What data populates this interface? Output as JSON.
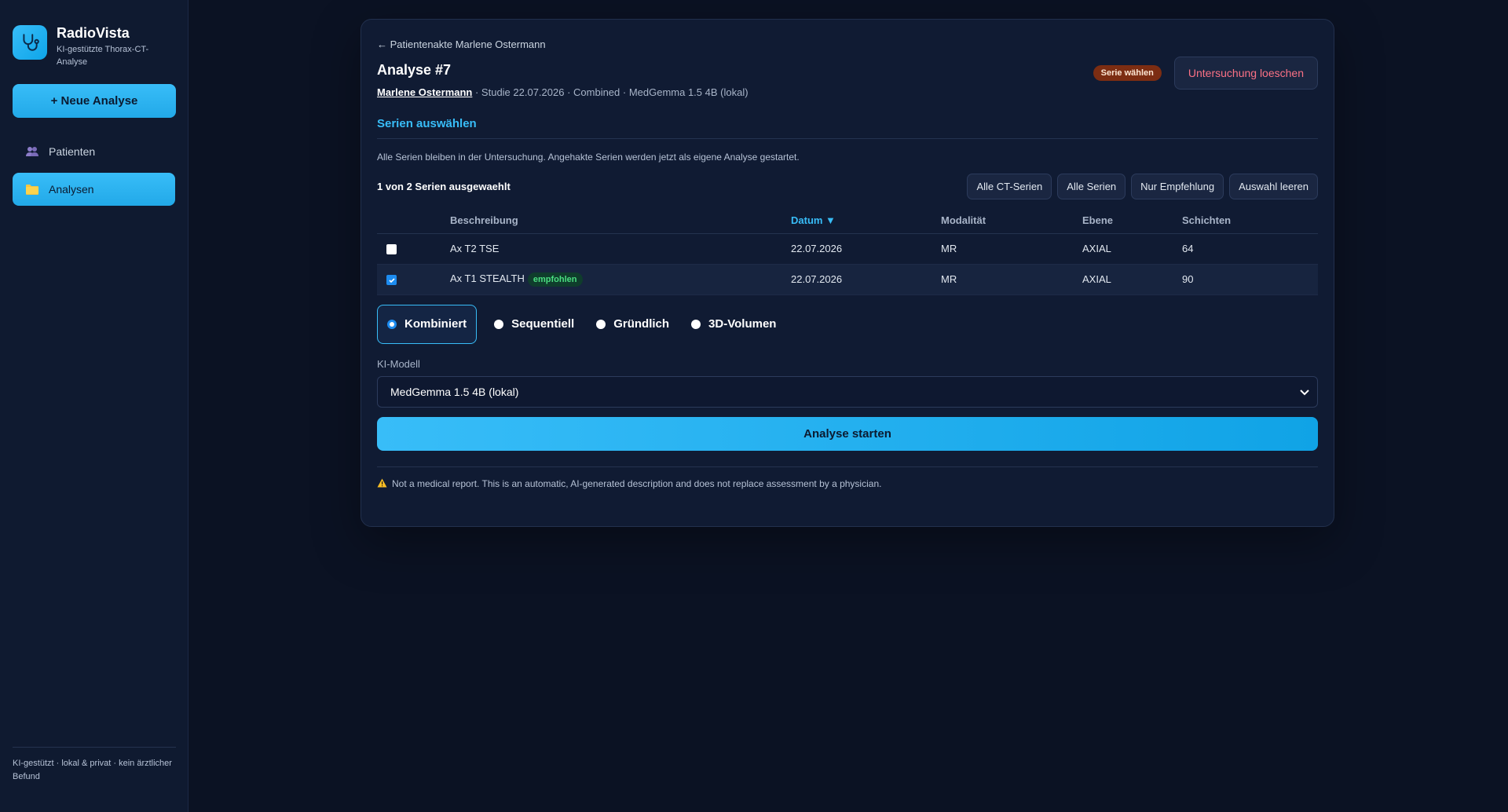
{
  "brand": {
    "name": "RadioVista",
    "subtitle": "KI-gestützte Thorax-CT-Analyse"
  },
  "sidebar": {
    "new_button": "+ Neue Analyse",
    "items": [
      {
        "label": "Patienten",
        "icon": "users-icon",
        "active": false
      },
      {
        "label": "Analysen",
        "icon": "folder-icon",
        "active": true
      }
    ],
    "footer": "KI-gestützt · lokal & privat · kein ärztlicher Befund"
  },
  "header": {
    "back_link": "← Patientenakte Marlene Ostermann",
    "title": "Analyse #7",
    "patient_name": "Marlene Ostermann",
    "meta_rest": " · Studie 22.07.2026 · Combined · MedGemma 1.5 4B (lokal)",
    "status_badge": "Serie wählen",
    "delete_button": "Untersuchung loeschen"
  },
  "series_section": {
    "title": "Serien auswählen",
    "info": "Alle Serien bleiben in der Untersuchung. Angehakte Serien werden jetzt als eigene Analyse gestartet.",
    "selection_count": "1 von 2 Serien ausgewaehlt",
    "filter_buttons": [
      "Alle CT-Serien",
      "Alle Serien",
      "Nur Empfehlung",
      "Auswahl leeren"
    ],
    "columns": [
      "Beschreibung",
      "Datum ▼",
      "Modalität",
      "Ebene",
      "Schichten"
    ],
    "rows": [
      {
        "checked": false,
        "description": "Ax T2 TSE",
        "badge": "",
        "date": "22.07.2026",
        "modality": "MR",
        "plane": "AXIAL",
        "slices": "64"
      },
      {
        "checked": true,
        "description": "Ax T1 STEALTH",
        "badge": "empfohlen",
        "date": "22.07.2026",
        "modality": "MR",
        "plane": "AXIAL",
        "slices": "90"
      }
    ]
  },
  "modes": {
    "options": [
      "Kombiniert",
      "Sequentiell",
      "Gründlich",
      "3D-Volumen"
    ],
    "selected": "Kombiniert"
  },
  "model": {
    "label": "KI-Modell",
    "selected": "MedGemma 1.5 4B (lokal)"
  },
  "start_button": "Analyse starten",
  "disclaimer": "Not a medical report. This is an automatic, AI-generated description and does not replace assessment by a physician.",
  "colors": {
    "accent": "#38bdf8",
    "danger": "#fb7185",
    "badge_warn": "#7c2d12",
    "badge_ok": "#4ade80"
  }
}
